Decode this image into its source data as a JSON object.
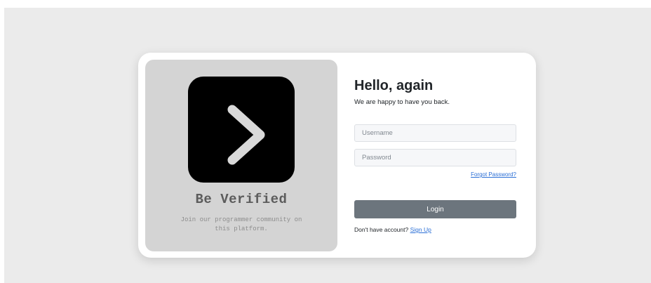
{
  "brand": {
    "logo_icon": "chevron-right-icon",
    "title": "Be Verified",
    "subtitle": "Join our programmer community on this platform."
  },
  "form": {
    "heading": "Hello, again",
    "subheading": "We are happy to have you back.",
    "username_placeholder": "Username",
    "password_placeholder": "Password",
    "forgot_label": "Forgot Password?",
    "login_label": "Login",
    "signup_prompt": "Don't have account?",
    "signup_label": "Sign Up"
  },
  "colors": {
    "background": "#ebebeb",
    "card": "#ffffff",
    "left_panel": "#d4d4d4",
    "logo_box": "#000000",
    "button": "#6c757d",
    "link": "#2b6fd6"
  }
}
